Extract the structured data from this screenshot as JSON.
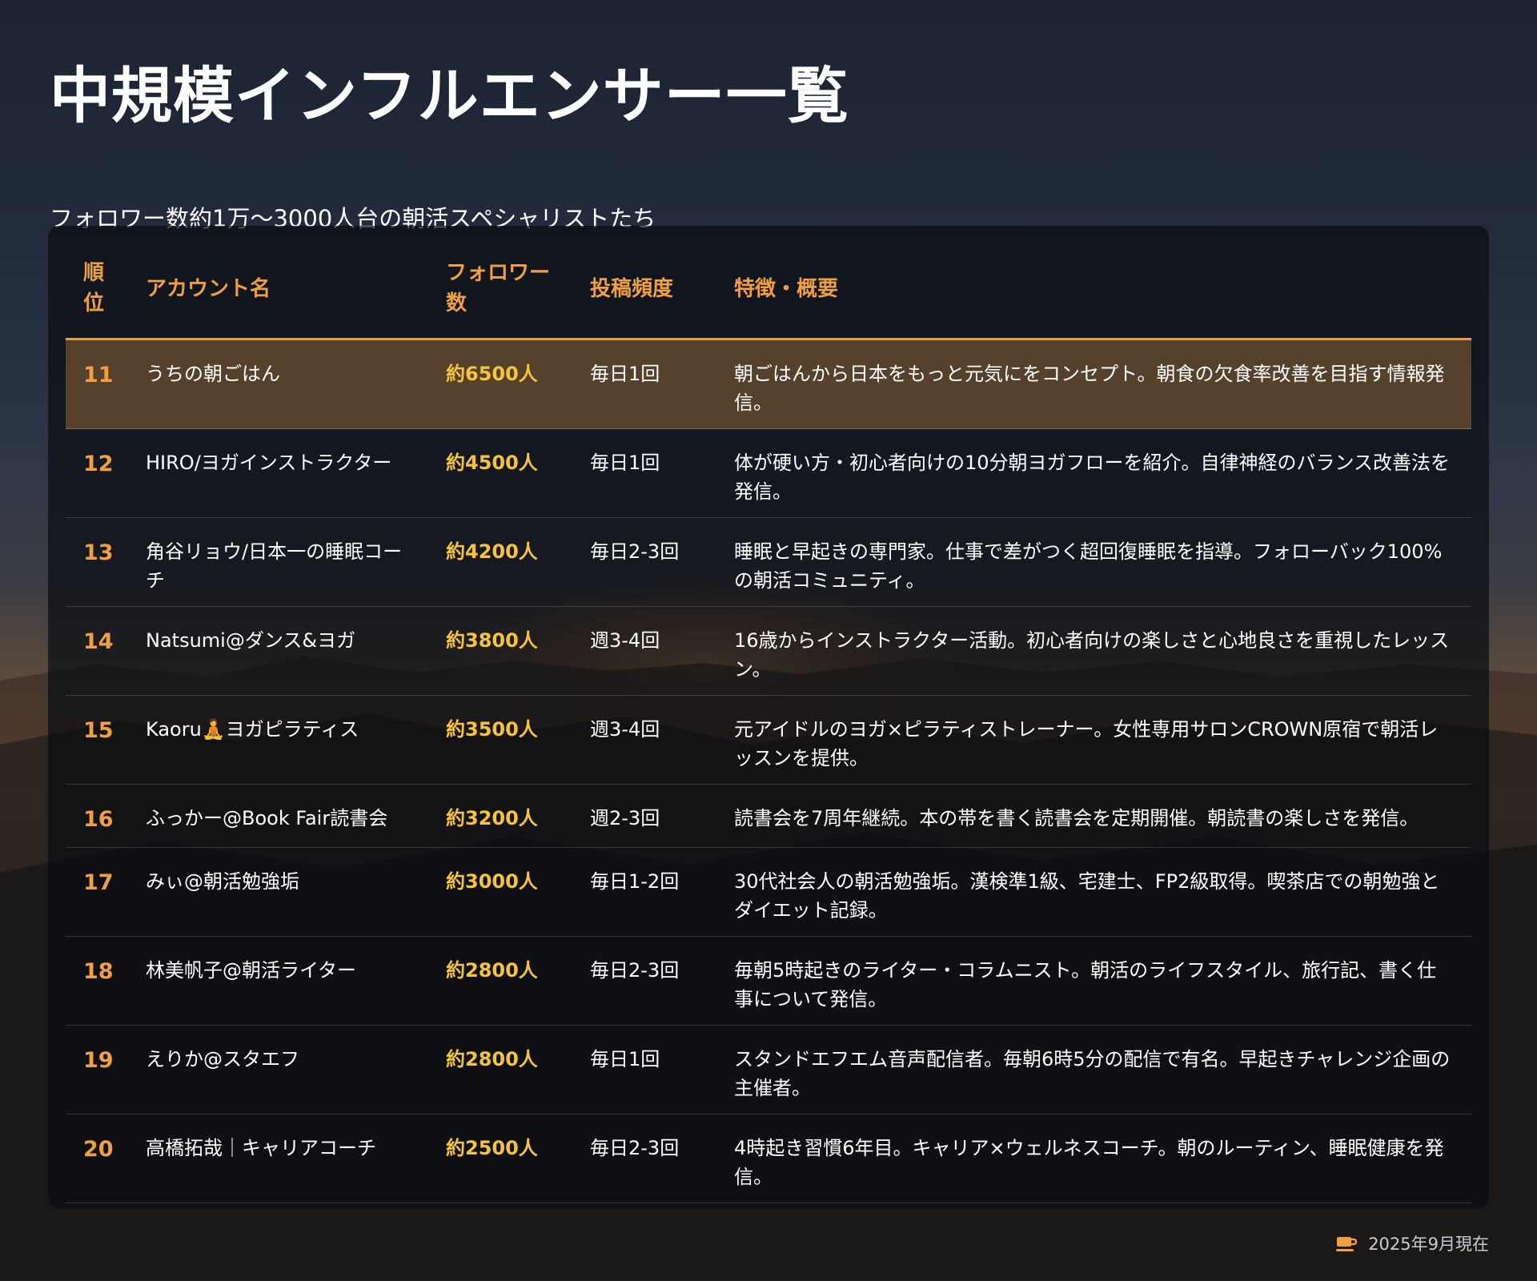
{
  "header": {
    "title": "中規模インフルエンサー一覧",
    "subtitle": "フォロワー数約1万〜3000人台の朝活スペシャリストたち"
  },
  "table": {
    "columns": {
      "rank": "順位",
      "account": "アカウント名",
      "followers": "フォロワー数",
      "frequency": "投稿頻度",
      "description": "特徴・概要"
    },
    "rows": [
      {
        "rank": "11",
        "account": "うちの朝ごはん",
        "followers": "約6500人",
        "frequency": "毎日1回",
        "description": "朝ごはんから日本をもっと元気にをコンセプト。朝食の欠食率改善を目指す情報発信。",
        "highlight": true
      },
      {
        "rank": "12",
        "account": "HIRO/ヨガインストラクター",
        "followers": "約4500人",
        "frequency": "毎日1回",
        "description": "体が硬い方・初心者向けの10分朝ヨガフローを紹介。自律神経のバランス改善法を発信。"
      },
      {
        "rank": "13",
        "account": "角谷リョウ/日本一の睡眠コーチ",
        "followers": "約4200人",
        "frequency": "毎日2-3回",
        "description": "睡眠と早起きの専門家。仕事で差がつく超回復睡眠を指導。フォローバック100%の朝活コミュニティ。"
      },
      {
        "rank": "14",
        "account": "Natsumi@ダンス&ヨガ",
        "followers": "約3800人",
        "frequency": "週3-4回",
        "description": "16歳からインストラクター活動。初心者向けの楽しさと心地良さを重視したレッスン。"
      },
      {
        "rank": "15",
        "account": "Kaoru🧘ヨガピラティス",
        "followers": "約3500人",
        "frequency": "週3-4回",
        "description": "元アイドルのヨガ×ピラティストレーナー。女性専用サロンCROWN原宿で朝活レッスンを提供。"
      },
      {
        "rank": "16",
        "account": "ふっかー@Book Fair読書会",
        "followers": "約3200人",
        "frequency": "週2-3回",
        "description": "読書会を7周年継続。本の帯を書く読書会を定期開催。朝読書の楽しさを発信。"
      },
      {
        "rank": "17",
        "account": "みぃ@朝活勉強垢",
        "followers": "約3000人",
        "frequency": "毎日1-2回",
        "description": "30代社会人の朝活勉強垢。漢検準1級、宅建士、FP2級取得。喫茶店での朝勉強とダイエット記録。"
      },
      {
        "rank": "18",
        "account": "林美帆子@朝活ライター",
        "followers": "約2800人",
        "frequency": "毎日2-3回",
        "description": "毎朝5時起きのライター・コラムニスト。朝活のライフスタイル、旅行記、書く仕事について発信。"
      },
      {
        "rank": "19",
        "account": "えりか@スタエフ",
        "followers": "約2800人",
        "frequency": "毎日1回",
        "description": "スタンドエフエム音声配信者。毎朝6時5分の配信で有名。早起きチャレンジ企画の主催者。"
      },
      {
        "rank": "20",
        "account": "高橋拓哉｜キャリアコーチ",
        "followers": "約2500人",
        "frequency": "毎日2-3回",
        "description": "4時起き習慣6年目。キャリア×ウェルネスコーチ。朝のルーティン、睡眠健康を発信。"
      }
    ]
  },
  "footer": {
    "icon": "coffee-cup-icon",
    "date": "2025年9月現在"
  },
  "colors": {
    "accent": "#f0a040",
    "followers": "#f4c43a",
    "highlight_row": "#6b4e32"
  }
}
